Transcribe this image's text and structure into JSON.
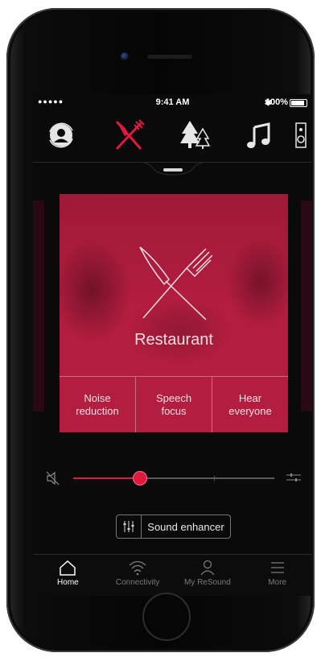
{
  "status_bar": {
    "signal": "●●●●● ",
    "time": "9:41 AM",
    "bluetooth": "✱",
    "battery": "100%"
  },
  "programs": [
    {
      "name": "all-around",
      "icon": "person-refresh-icon",
      "active": false
    },
    {
      "name": "restaurant",
      "icon": "knife-fork-icon",
      "active": true
    },
    {
      "name": "outdoor",
      "icon": "trees-icon",
      "active": false
    },
    {
      "name": "music",
      "icon": "music-note-icon",
      "active": false
    },
    {
      "name": "speaker",
      "icon": "speaker-icon",
      "active": false
    }
  ],
  "card": {
    "title": "Restaurant",
    "modes": [
      {
        "label": "Noise\nreduction"
      },
      {
        "label": "Speech\nfocus"
      },
      {
        "label": "Hear\neveryone"
      }
    ],
    "accent": "#b31d3f"
  },
  "volume": {
    "level": 0.33,
    "accent": "#e0193f"
  },
  "sound_enhancer": {
    "label": "Sound enhancer"
  },
  "tabbar": [
    {
      "label": "Home",
      "icon": "home-icon",
      "active": true
    },
    {
      "label": "Connectivity",
      "icon": "wifi-icon",
      "active": false
    },
    {
      "label": "My ReSound",
      "icon": "person-icon",
      "active": false
    },
    {
      "label": "More",
      "icon": "menu-icon",
      "active": false
    }
  ]
}
